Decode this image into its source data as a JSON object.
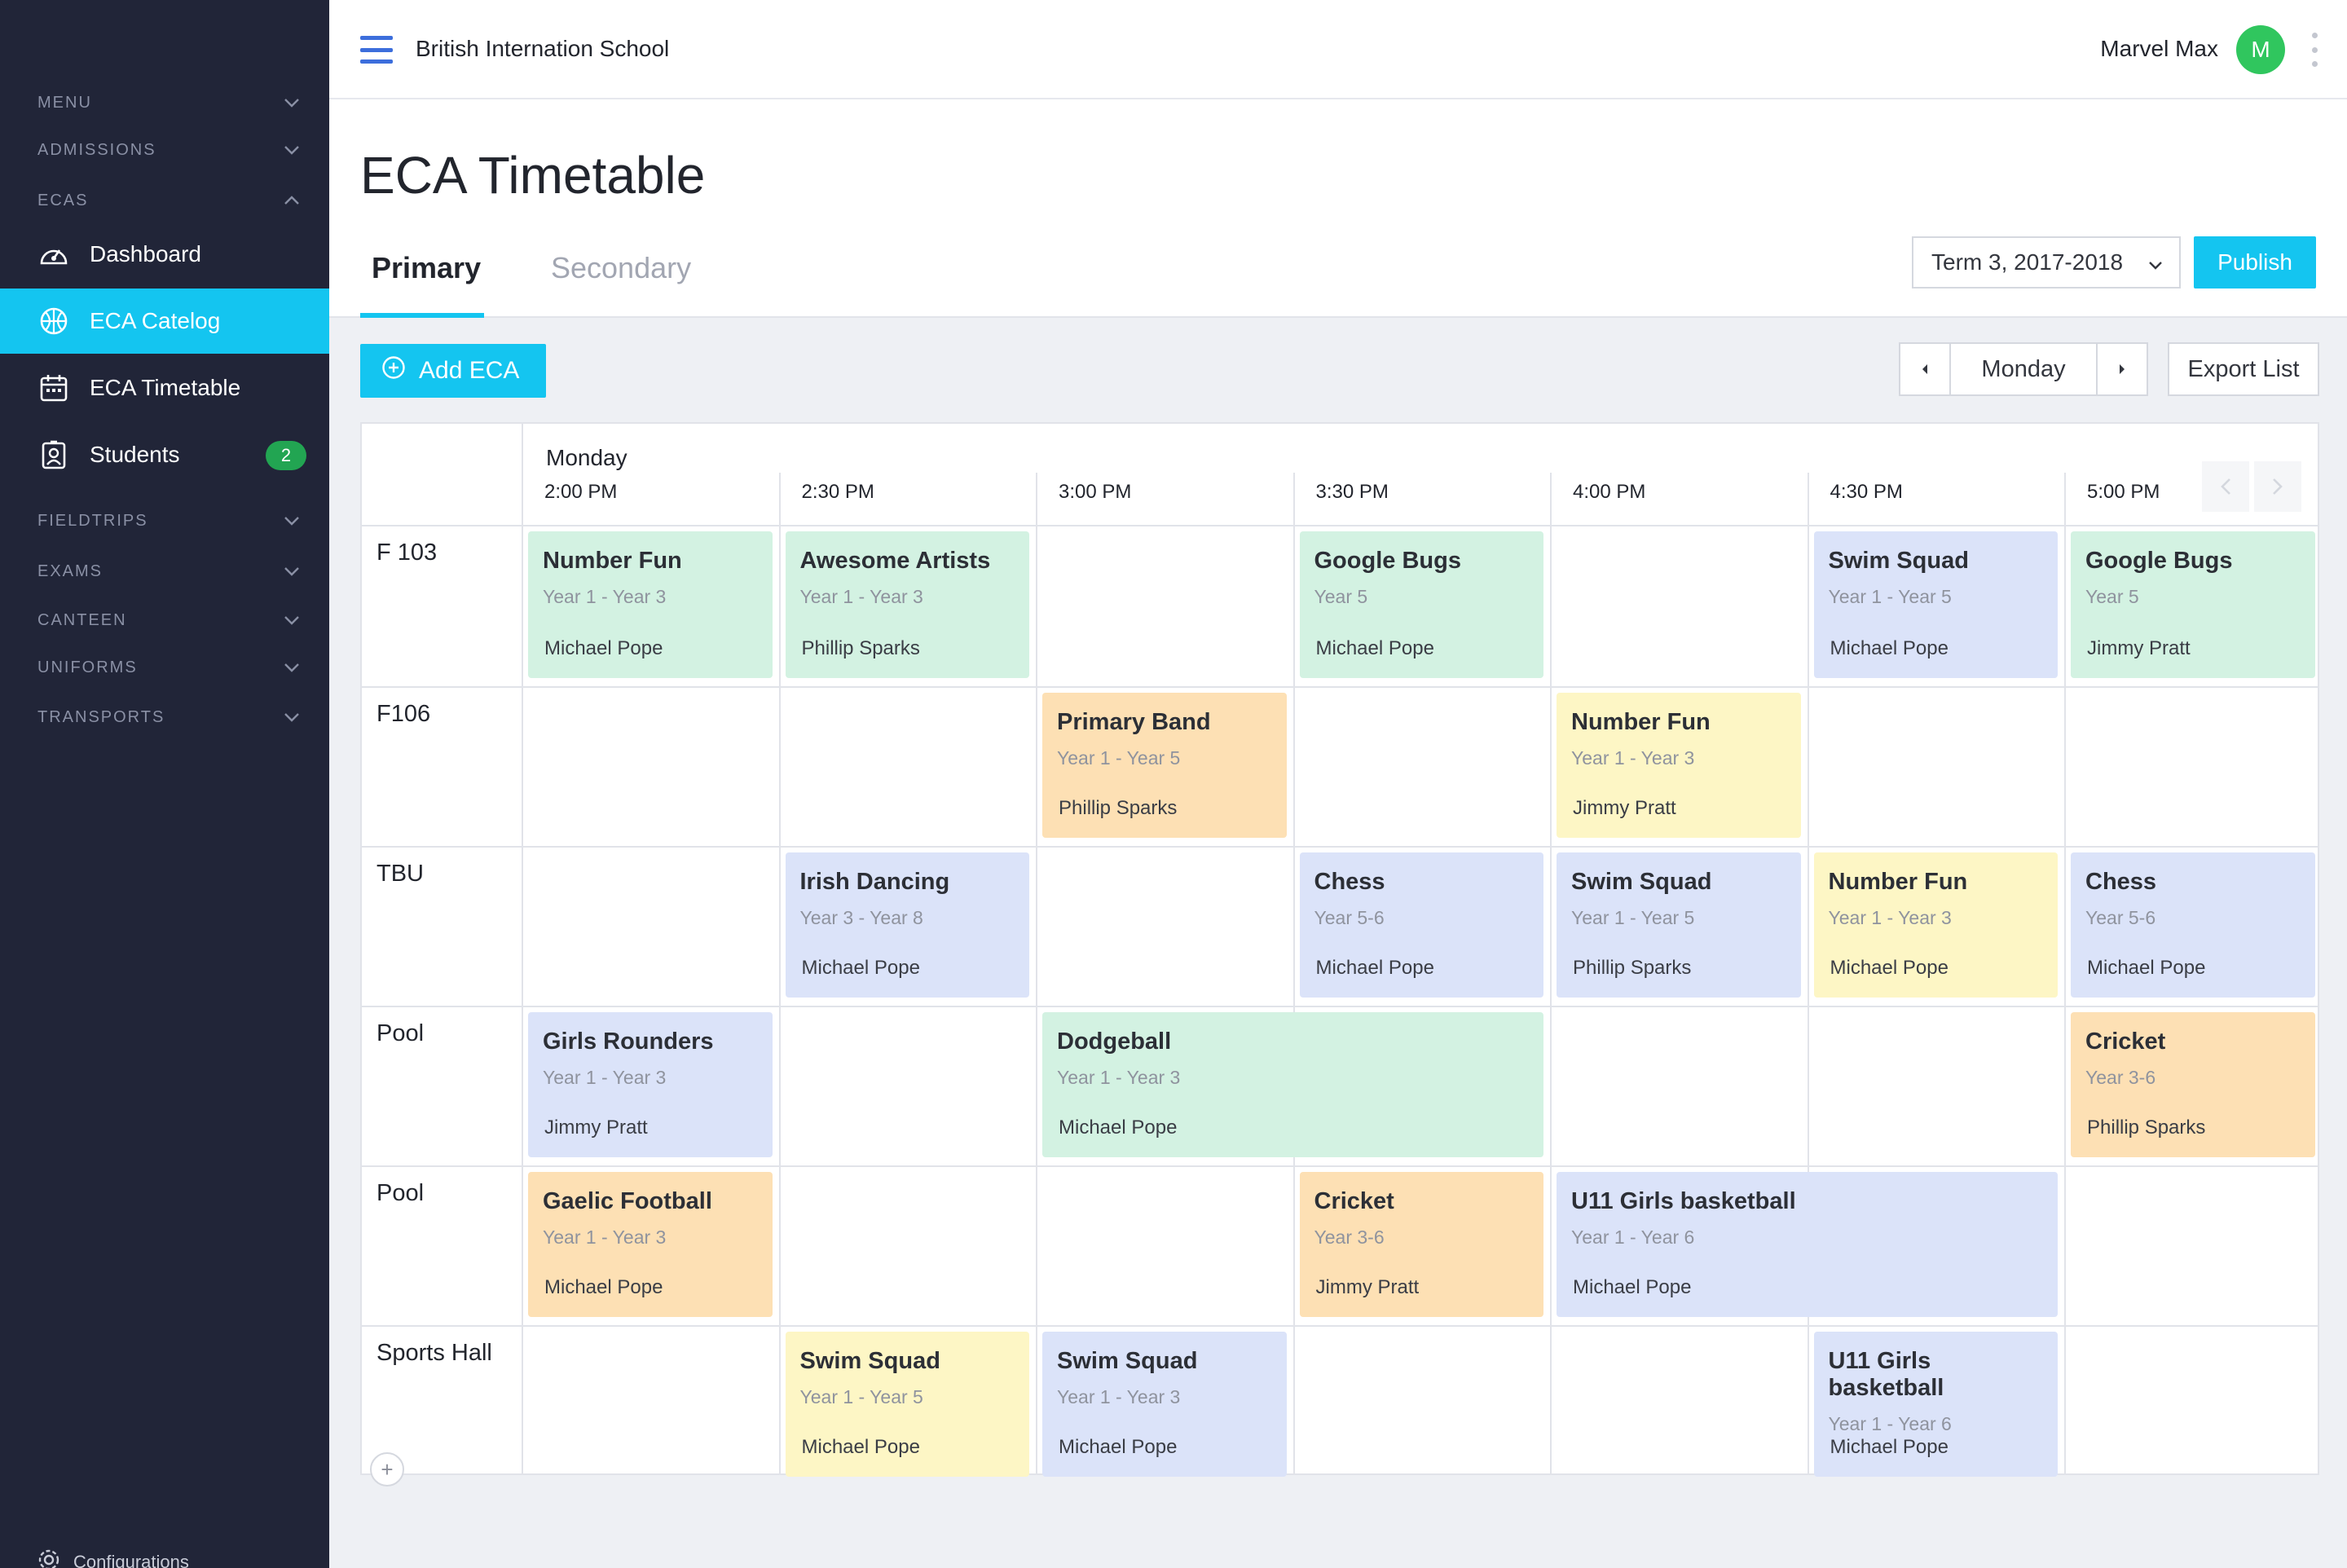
{
  "app": {
    "school_name": "British Internation School"
  },
  "user": {
    "name": "Marvel Max",
    "avatar_initial": "M"
  },
  "sidebar": {
    "sections_top": [
      {
        "label": "MENU",
        "expanded": false
      },
      {
        "label": "ADMISSIONS",
        "expanded": false
      },
      {
        "label": "ECAS",
        "expanded": true
      }
    ],
    "items": [
      {
        "label": "Dashboard",
        "icon": "dashboard-icon",
        "active": false
      },
      {
        "label": "ECA Catelog",
        "icon": "basketball-icon",
        "active": true
      },
      {
        "label": "ECA Timetable",
        "icon": "calendar-icon",
        "active": false
      },
      {
        "label": "Students",
        "icon": "student-badge-icon",
        "active": false,
        "badge": "2"
      }
    ],
    "sections_bottom": [
      {
        "label": "FIELDTRIPS"
      },
      {
        "label": "EXAMS"
      },
      {
        "label": "CANTEEN"
      },
      {
        "label": "UNIFORMS"
      },
      {
        "label": "TRANSPORTS"
      }
    ],
    "footer_label": "Configurations"
  },
  "page": {
    "title": "ECA Timetable",
    "tabs": [
      "Primary",
      "Secondary"
    ],
    "active_tab": "Primary",
    "term": "Term 3, 2017-2018",
    "publish_label": "Publish",
    "add_label": "Add ECA",
    "day": "Monday",
    "export_label": "Export List"
  },
  "timetable": {
    "day_header": "Monday",
    "times": [
      "2:00 PM",
      "2:30 PM",
      "3:00 PM",
      "3:30 PM",
      "4:00 PM",
      "4:30 PM",
      "5:00 PM"
    ],
    "rows": [
      "F 103",
      "F106",
      "TBU",
      "Pool",
      "Pool",
      "Sports Hall"
    ],
    "cards": [
      {
        "row": 0,
        "col": 0,
        "span": 1,
        "title": "Number Fun",
        "years": "Year 1 - Year 3",
        "teacher": "Michael Pope",
        "color": "green"
      },
      {
        "row": 0,
        "col": 1,
        "span": 1,
        "title": "Awesome Artists",
        "years": "Year 1 - Year 3",
        "teacher": "Phillip Sparks",
        "color": "green"
      },
      {
        "row": 0,
        "col": 3,
        "span": 1,
        "title": "Google Bugs",
        "years": "Year 5",
        "teacher": "Michael Pope",
        "color": "green"
      },
      {
        "row": 0,
        "col": 5,
        "span": 1,
        "title": "Swim Squad",
        "years": "Year 1 - Year 5",
        "teacher": "Michael Pope",
        "color": "blue"
      },
      {
        "row": 0,
        "col": 6,
        "span": 1,
        "title": "Google Bugs",
        "years": "Year 5",
        "teacher": "Jimmy Pratt",
        "color": "green"
      },
      {
        "row": 1,
        "col": 2,
        "span": 1,
        "title": "Primary Band",
        "years": "Year 1 - Year 5",
        "teacher": "Phillip Sparks",
        "color": "orange"
      },
      {
        "row": 1,
        "col": 4,
        "span": 1,
        "title": "Number Fun",
        "years": "Year 1 - Year 3",
        "teacher": "Jimmy Pratt",
        "color": "yellow"
      },
      {
        "row": 2,
        "col": 1,
        "span": 1,
        "title": "Irish Dancing",
        "years": "Year 3 - Year 8",
        "teacher": "Michael Pope",
        "color": "blue"
      },
      {
        "row": 2,
        "col": 3,
        "span": 1,
        "title": "Chess",
        "years": "Year 5-6",
        "teacher": "Michael Pope",
        "color": "blue"
      },
      {
        "row": 2,
        "col": 4,
        "span": 1,
        "title": "Swim Squad",
        "years": "Year 1 - Year 5",
        "teacher": "Phillip Sparks",
        "color": "blue"
      },
      {
        "row": 2,
        "col": 5,
        "span": 1,
        "title": "Number Fun",
        "years": "Year 1 - Year 3",
        "teacher": "Michael Pope",
        "color": "yellow"
      },
      {
        "row": 2,
        "col": 6,
        "span": 1,
        "title": "Chess",
        "years": "Year 5-6",
        "teacher": "Michael Pope",
        "color": "blue"
      },
      {
        "row": 3,
        "col": 0,
        "span": 1,
        "title": "Girls Rounders",
        "years": "Year 1 - Year 3",
        "teacher": "Jimmy Pratt",
        "color": "blue"
      },
      {
        "row": 3,
        "col": 2,
        "span": 2,
        "title": "Dodgeball",
        "years": "Year 1 - Year 3",
        "teacher": "Michael Pope",
        "color": "green"
      },
      {
        "row": 3,
        "col": 6,
        "span": 1,
        "title": "Cricket",
        "years": "Year 3-6",
        "teacher": "Phillip Sparks",
        "color": "orange"
      },
      {
        "row": 4,
        "col": 0,
        "span": 1,
        "title": "Gaelic Football",
        "years": "Year 1 - Year 3",
        "teacher": "Michael Pope",
        "color": "orange"
      },
      {
        "row": 4,
        "col": 3,
        "span": 1,
        "title": "Cricket",
        "years": "Year 3-6",
        "teacher": "Jimmy Pratt",
        "color": "orange"
      },
      {
        "row": 4,
        "col": 4,
        "span": 2,
        "title": "U11 Girls basketball",
        "years": "Year 1 - Year 6",
        "teacher": "Michael Pope",
        "color": "blue"
      },
      {
        "row": 5,
        "col": 1,
        "span": 1,
        "title": "Swim Squad",
        "years": "Year 1 - Year 5",
        "teacher": "Michael Pope",
        "color": "yellow"
      },
      {
        "row": 5,
        "col": 2,
        "span": 1,
        "title": "Swim Squad",
        "years": "Year 1 - Year 3",
        "teacher": "Michael Pope",
        "color": "blue"
      },
      {
        "row": 5,
        "col": 5,
        "span": 1,
        "title": "U11 Girls basketball",
        "years": "Year 1 - Year 6",
        "teacher": "Michael Pope",
        "color": "blue"
      }
    ]
  },
  "colors": {
    "accent": "#14c5f0",
    "sidebar_bg": "#212538",
    "badge_green": "#22a552",
    "avatar_green": "#30c65e"
  }
}
